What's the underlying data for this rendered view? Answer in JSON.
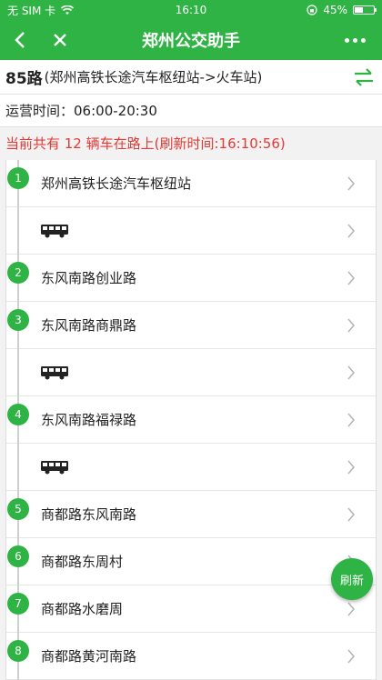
{
  "status_bar": {
    "carrier": "无 SIM 卡",
    "time": "16:10",
    "battery": "45%",
    "battery_level": 0.45
  },
  "navbar": {
    "title": "郑州公交助手"
  },
  "route": {
    "number": "85路",
    "direction": "(郑州高铁长途汽车枢纽站->火车站)"
  },
  "hours": {
    "label": "运营时间：",
    "value": "06:00-20:30"
  },
  "notice": "当前共有 12 辆车在路上(刷新时间:16:10:56)",
  "stops": [
    {
      "type": "stop",
      "index": "1",
      "name": "郑州高铁长途汽车枢纽站"
    },
    {
      "type": "bus"
    },
    {
      "type": "stop",
      "index": "2",
      "name": "东风南路创业路"
    },
    {
      "type": "stop",
      "index": "3",
      "name": "东风南路商鼎路"
    },
    {
      "type": "bus"
    },
    {
      "type": "stop",
      "index": "4",
      "name": "东风南路福禄路"
    },
    {
      "type": "bus"
    },
    {
      "type": "stop",
      "index": "5",
      "name": "商都路东风南路"
    },
    {
      "type": "stop",
      "index": "6",
      "name": "商都路东周村"
    },
    {
      "type": "stop",
      "index": "7",
      "name": "商都路水磨周"
    },
    {
      "type": "stop",
      "index": "8",
      "name": "商都路黄河南路"
    }
  ],
  "refresh_label": "刷新",
  "colors": {
    "brand": "#2fb344",
    "alert": "#e53935"
  }
}
